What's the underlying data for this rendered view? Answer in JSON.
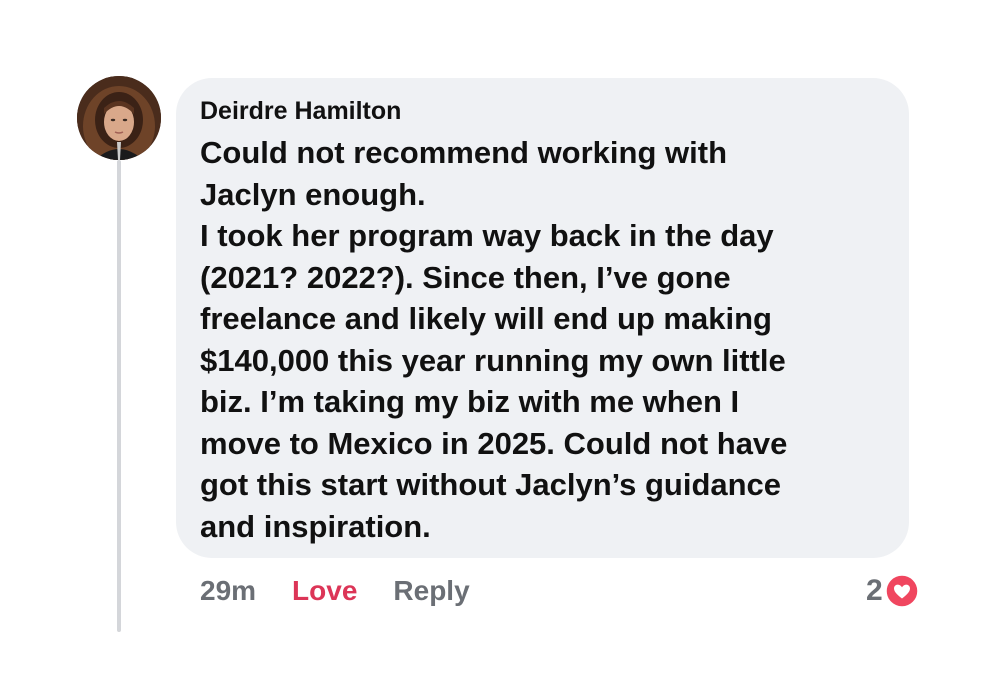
{
  "comment": {
    "author": "Deirdre Hamilton",
    "lines": [
      "Could not recommend working with",
      "Jaclyn enough.",
      "I took her program way back in the day",
      "(2021? 2022?). Since then, I’ve gone",
      "freelance and likely will end up making",
      "$140,000 this year running my own little",
      "biz. I’m taking my biz with me when I",
      "move to Mexico in 2025. Could not have",
      "got this start without Jaclyn’s guidance",
      "and inspiration."
    ]
  },
  "actions": {
    "time": "29m",
    "love_label": "Love",
    "reply_label": "Reply"
  },
  "reactions": {
    "count": "2",
    "icon": "heart-icon"
  },
  "colors": {
    "bubble": "#eff1f4",
    "love": "#dc3557",
    "muted": "#6b6f75",
    "heart": "#f0465f"
  }
}
